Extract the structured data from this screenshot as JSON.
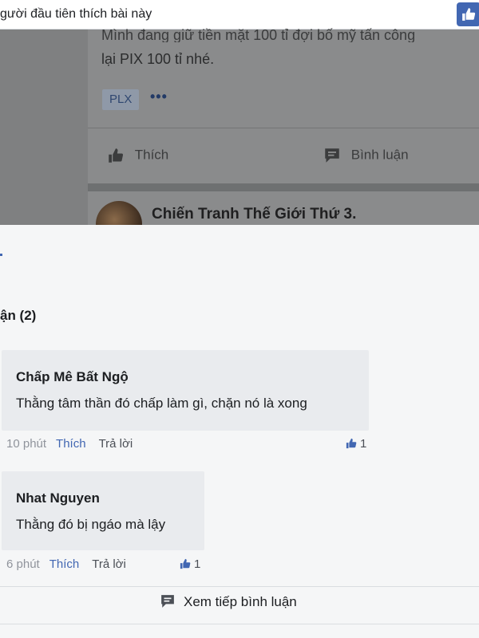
{
  "top_bar": {
    "likers_text": "gười đầu tiên thích bài này"
  },
  "post": {
    "text_line1": "Mình đang giữ tiền mặt 100 tỉ đợi bố mỹ tấn công",
    "text_line2": "lại PIX 100 tỉ nhé.",
    "tag": "PLX",
    "more": "•••",
    "like_label": "Thích",
    "comment_label": "Bình luận"
  },
  "next_post": {
    "author": "Chiến Tranh Thế Giới Thứ 3."
  },
  "comments_section": {
    "heading": "ận (2)",
    "comments": [
      {
        "author": "Chấp Mê Bất Ngộ",
        "text": "Thằng tâm thần đó chấp làm gì, chặn nó là xong",
        "time": "10 phút",
        "like": "Thích",
        "reply": "Trả lời",
        "reactions": "1"
      },
      {
        "author": "Nhat Nguyen",
        "text": "Thằng đó bị ngáo mà lậy",
        "time": "6 phút",
        "like": "Thích",
        "reply": "Trả lời",
        "reactions": "1"
      }
    ],
    "more_comments": "Xem tiếp bình luận"
  },
  "colors": {
    "accent": "#4267b2",
    "bubble": "#e9ebee",
    "overlay": "#7f8081"
  }
}
